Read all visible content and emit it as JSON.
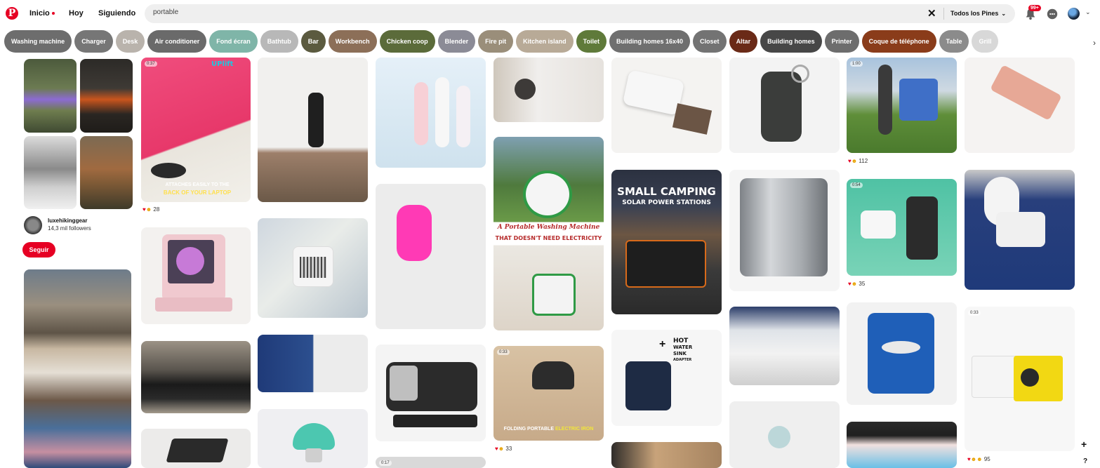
{
  "header": {
    "logo": "P",
    "nav": {
      "home": "Inicio",
      "today": "Hoy",
      "following": "Siguiendo"
    },
    "search": {
      "value": "portable",
      "clear_icon": "close-icon"
    },
    "filter": {
      "label": "Todos los Pines",
      "chevron": "⌄"
    },
    "notifications_badge": "99+",
    "icons": [
      "bell-icon",
      "chat-icon",
      "avatar",
      "chevron-down-icon"
    ]
  },
  "chips": [
    {
      "label": "Washing machine",
      "color": "#6d6d6d"
    },
    {
      "label": "Charger",
      "color": "#767676"
    },
    {
      "label": "Desk",
      "color": "#b9b3ac"
    },
    {
      "label": "Air conditioner",
      "color": "#6a6a6a"
    },
    {
      "label": "Fond écran",
      "color": "#7fb5a8"
    },
    {
      "label": "Bathtub",
      "color": "#b8b8b8"
    },
    {
      "label": "Bar",
      "color": "#5b5a3f"
    },
    {
      "label": "Workbench",
      "color": "#8c6f58"
    },
    {
      "label": "Chicken coop",
      "color": "#5b6b3a"
    },
    {
      "label": "Blender",
      "color": "#8b8b96"
    },
    {
      "label": "Fire pit",
      "color": "#9a8e7a"
    },
    {
      "label": "Kitchen island",
      "color": "#b8aa97"
    },
    {
      "label": "Toilet",
      "color": "#5f7a3a"
    },
    {
      "label": "Building homes 16x40",
      "color": "#6f6f6f"
    },
    {
      "label": "Closet",
      "color": "#737373"
    },
    {
      "label": "Altar",
      "color": "#6a2a17"
    },
    {
      "label": "Building homes",
      "color": "#474747"
    },
    {
      "label": "Printer",
      "color": "#6d6d6d"
    },
    {
      "label": "Coque de téléphone",
      "color": "#8a3c1a"
    },
    {
      "label": "Table",
      "color": "#8b8b8b"
    },
    {
      "label": "Grill",
      "color": "#d8d8d8"
    }
  ],
  "pins": {
    "laptop_strap": {
      "badge": "0:37",
      "overlay_line1": "ATTACHES EASILY TO THE",
      "overlay_line2": "BACK OF YOUR LAPTOP",
      "brand": "UPlift",
      "reaction_count": "28"
    },
    "camping_stations": {
      "title_line1": "SMALL CAMPING",
      "title_line2": "SOLAR POWER STATIONS"
    },
    "washing_machine": {
      "caption_line1": "A Portable Washing Machine",
      "caption_line2": "THAT DOESN'T NEED ELECTRICITY"
    },
    "iron": {
      "badge": "0:33",
      "caption_white": "FOLDING PORTABLE ",
      "caption_yellow": "ELECTRIC IRON",
      "reaction_count": "33"
    },
    "chair": {
      "badge": "1:00",
      "reaction_count": "112"
    },
    "printer_small": {
      "badge": "0:54",
      "reaction_count": "35"
    },
    "projector": {
      "badge": "0:33",
      "reaction_count": "95"
    },
    "sink": {
      "label_hot": "HOT",
      "label_water": "WATER",
      "label_sink": "SINK",
      "label_adapter": "ADAPTER"
    },
    "bottom_badge": "0:17"
  },
  "creator": {
    "name": "luxehikinggear",
    "followers": "14,3 mil followers",
    "follow_label": "Seguir"
  },
  "floating": {
    "plus": "+",
    "help": "?"
  },
  "colors": {
    "brand": "#e60023"
  }
}
